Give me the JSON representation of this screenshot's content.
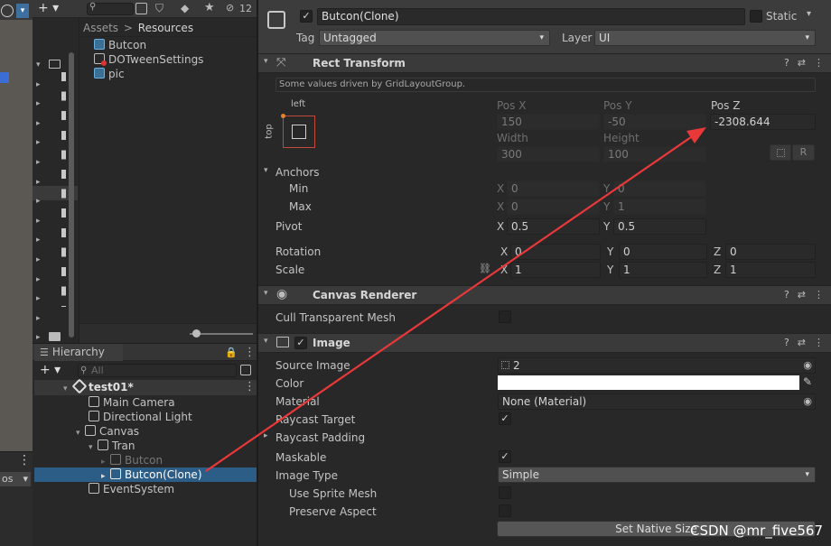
{
  "top_toolbar": {
    "add_label": "+ ▾",
    "search_placeholder": "",
    "hidden_count": "12"
  },
  "project": {
    "breadcrumb_assets": "Assets",
    "breadcrumb_sep": ">",
    "breadcrumb_resources": "Resources",
    "items": [
      {
        "label": "Butcon",
        "icon": "prefab-icon"
      },
      {
        "label": "DOTweenSettings",
        "icon": "scriptable-object-icon"
      },
      {
        "label": "pic",
        "icon": "prefab-icon"
      }
    ]
  },
  "hierarchy": {
    "tab": "Hierarchy",
    "search_placeholder": "All",
    "scene": "test01*",
    "rows": [
      "Main Camera",
      "Directional Light",
      "Canvas",
      "Tran",
      "Butcon",
      "Butcon(Clone)",
      "EventSystem"
    ]
  },
  "scene_panel": {
    "dropdown": "os"
  },
  "inspector": {
    "object_name": "Butcon(Clone)",
    "static_label": "Static",
    "tag_label": "Tag",
    "tag_value": "Untagged",
    "layer_label": "Layer",
    "layer_value": "UI",
    "rect_transform": {
      "title": "Rect Transform",
      "note": "Some values driven by GridLayoutGroup.",
      "anchor_preset_h": "left",
      "anchor_preset_v": "top",
      "pos_x_label": "Pos X",
      "pos_x": "150",
      "pos_y_label": "Pos Y",
      "pos_y": "-50",
      "pos_z_label": "Pos Z",
      "pos_z": "-2308.644",
      "width_label": "Width",
      "width": "300",
      "height_label": "Height",
      "height": "100",
      "r_button": "R",
      "anchors_label": "Anchors",
      "min_label": "Min",
      "min_x": "0",
      "min_y": "0",
      "max_label": "Max",
      "max_x": "0",
      "max_y": "1",
      "pivot_label": "Pivot",
      "pivot_x": "0.5",
      "pivot_y": "0.5",
      "rotation_label": "Rotation",
      "rot_x": "0",
      "rot_y": "0",
      "rot_z": "0",
      "scale_label": "Scale",
      "scale_x": "1",
      "scale_y": "1",
      "scale_z": "1",
      "x": "X",
      "y": "Y",
      "z": "Z"
    },
    "canvas_renderer": {
      "title": "Canvas Renderer",
      "cull_label": "Cull Transparent Mesh"
    },
    "image": {
      "title": "Image",
      "source_image_label": "Source Image",
      "source_image_value": "2",
      "color_label": "Color",
      "material_label": "Material",
      "material_value": "None (Material)",
      "raycast_target_label": "Raycast Target",
      "raycast_padding_label": "Raycast Padding",
      "maskable_label": "Maskable",
      "image_type_label": "Image Type",
      "image_type_value": "Simple",
      "use_sprite_mesh_label": "Use Sprite Mesh",
      "preserve_aspect_label": "Preserve Aspect",
      "set_native_size": "Set Native Size"
    }
  },
  "watermark": "CSDN @mr_five567",
  "colors": {
    "selection": "#2c5d87",
    "annotation_arrow": "#e8383a",
    "panel_bg": "#282828",
    "header_bg": "#3a3a3a"
  }
}
